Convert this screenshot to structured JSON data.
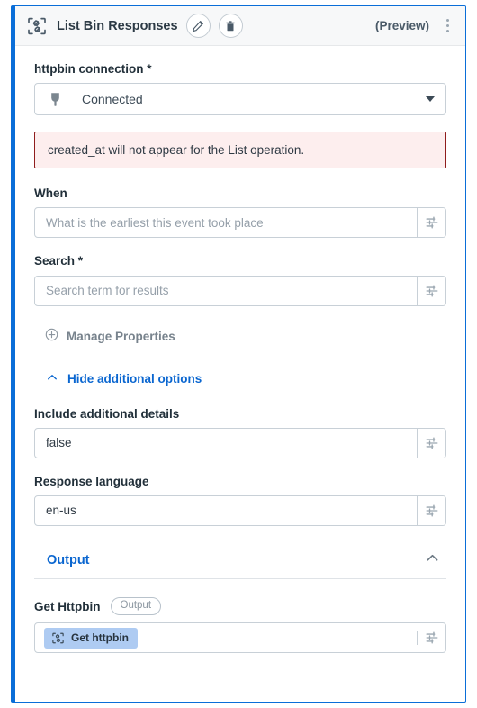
{
  "header": {
    "app_icon": "integration-nodes-icon",
    "title": "List Bin Responses",
    "edit_icon": "pencil-icon",
    "delete_icon": "trash-icon",
    "preview_label": "(Preview)",
    "menu_icon": "kebab-menu-icon"
  },
  "connection": {
    "label": "httpbin connection *",
    "icon": "plug-icon",
    "value": "Connected",
    "caret_icon": "chevron-down-icon"
  },
  "alert": {
    "message": "created_at will not appear for the List operation."
  },
  "when": {
    "label": "When",
    "placeholder": "What is the earliest this event took place",
    "value": "",
    "sliders_icon": "sliders-icon"
  },
  "search": {
    "label": "Search *",
    "placeholder": "Search term for results",
    "value": "",
    "sliders_icon": "sliders-icon"
  },
  "manage_properties": {
    "icon": "plus-circle-icon",
    "label": "Manage Properties"
  },
  "additional_options_toggle": {
    "icon": "chevron-up-icon",
    "label": "Hide additional options"
  },
  "include_details": {
    "label": "Include additional details",
    "value": "false",
    "sliders_icon": "sliders-icon"
  },
  "response_language": {
    "label": "Response language",
    "value": "en-us",
    "sliders_icon": "sliders-icon"
  },
  "output_section": {
    "title": "Output",
    "collapse_icon": "chevron-up-icon"
  },
  "get_httpbin": {
    "label": "Get Httpbin",
    "badge": "Output",
    "chip_icon": "integration-nodes-icon",
    "chip_label": "Get httpbin",
    "sliders_icon": "sliders-icon"
  },
  "colors": {
    "accent_blue": "#0a6ed8",
    "link_blue": "#0a66d0",
    "alert_border": "#8f1d1d",
    "alert_bg": "#fdeeee",
    "chip_bg": "#aecbf2",
    "border_gray": "#c8d0d7",
    "header_bg": "#f7f8f9"
  }
}
